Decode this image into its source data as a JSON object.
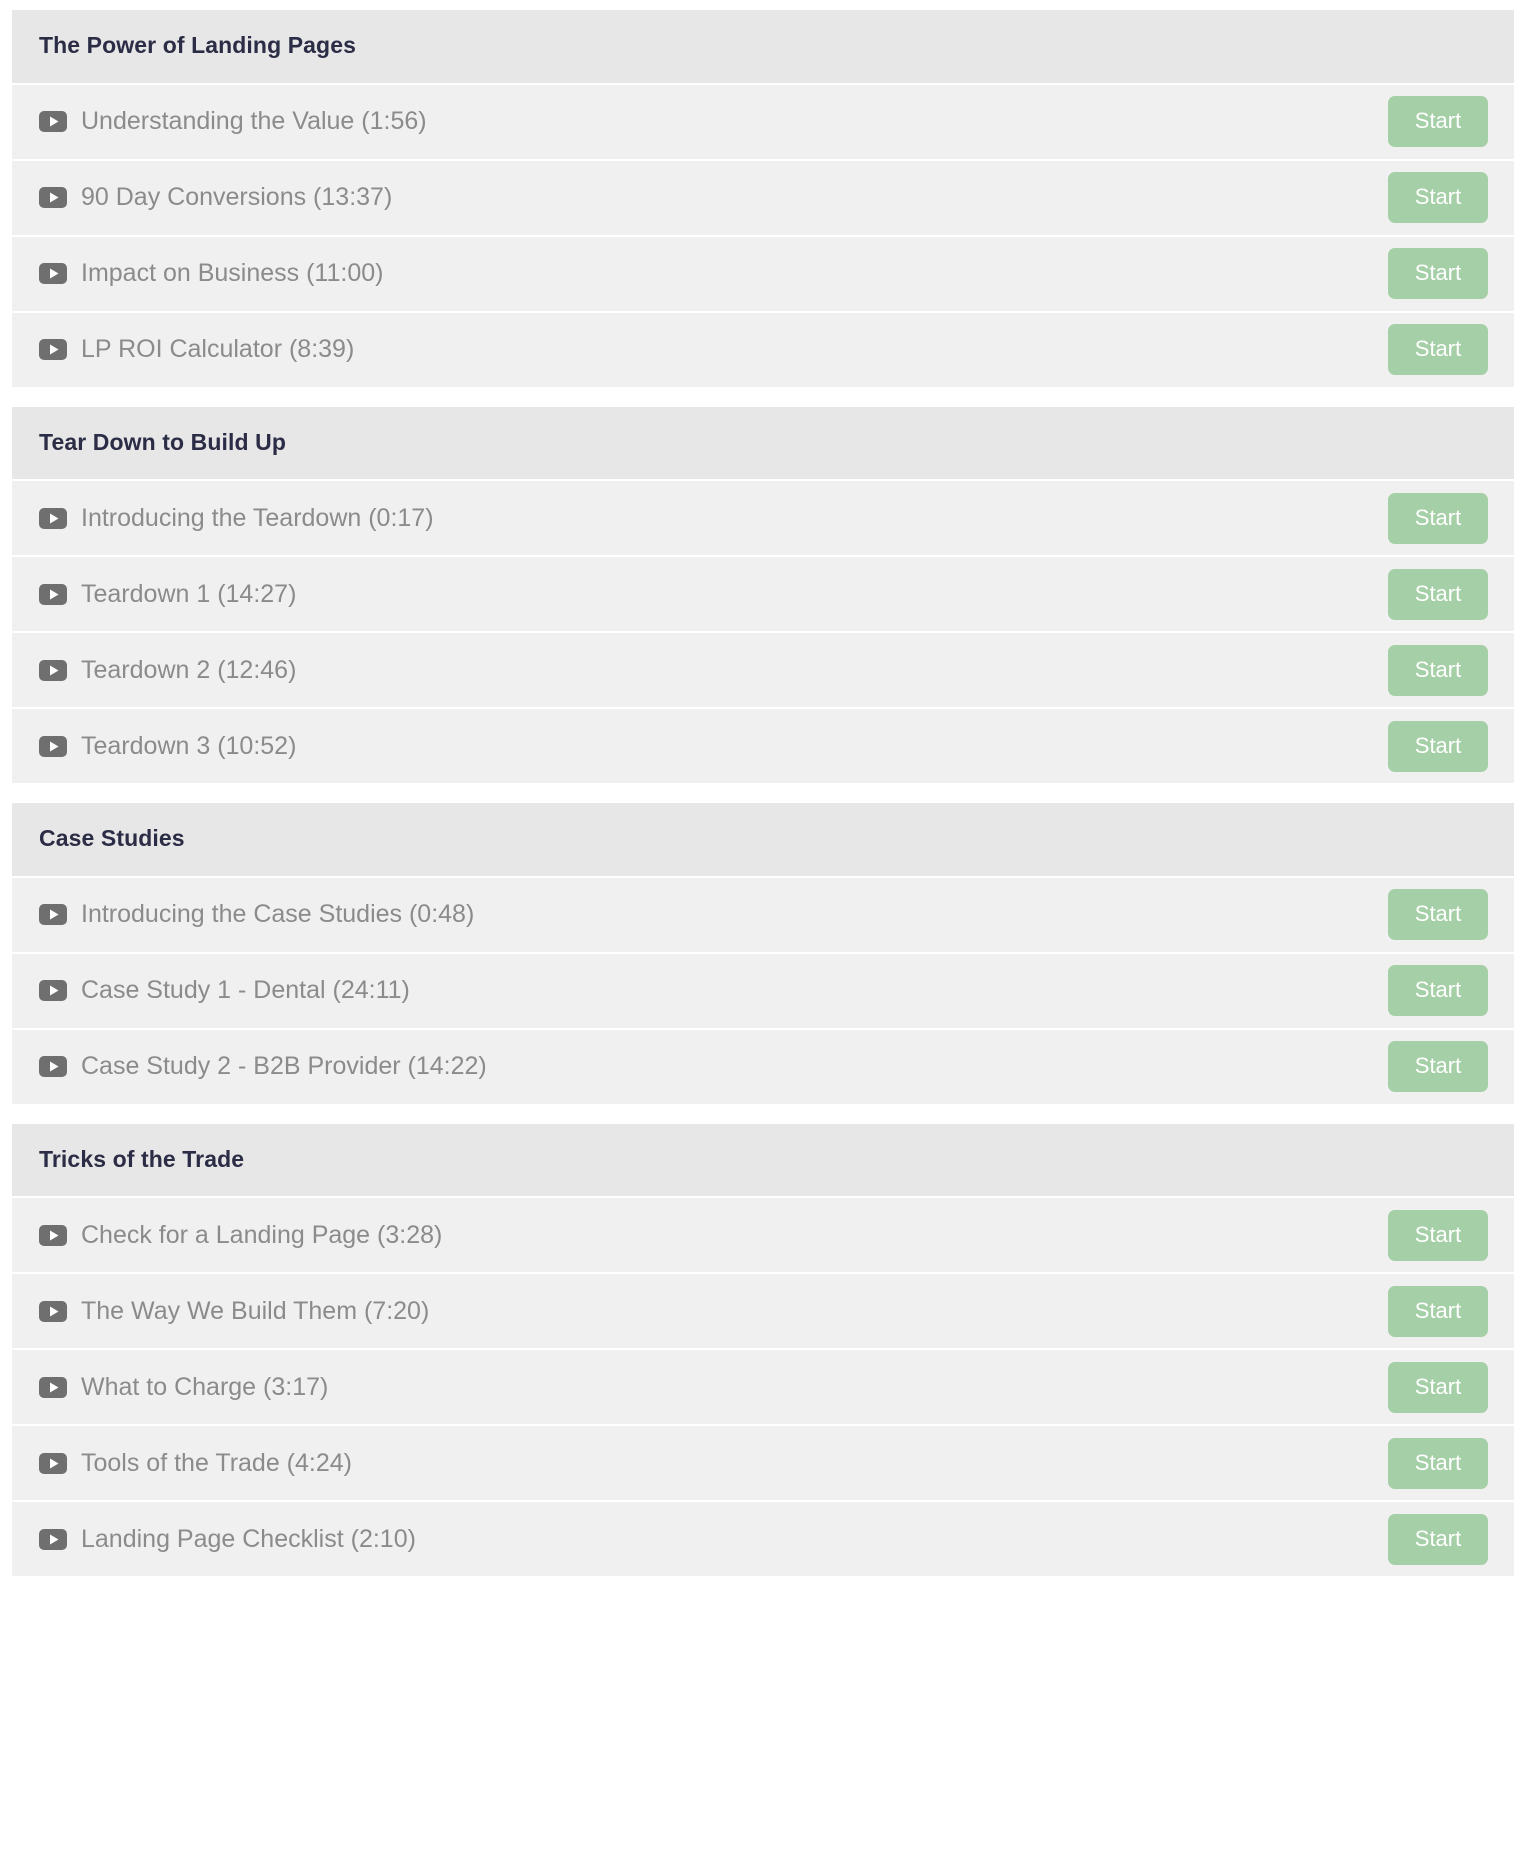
{
  "course": {
    "icon_name": "play-video-icon",
    "accent_color": "#a5cfa6",
    "header_bg": "#e7e7e7",
    "row_bg": "#f0f0f0",
    "title_color": "#2b2c45",
    "label_color": "#8b8b8b",
    "start_label": "Start",
    "sections": [
      {
        "title": "The Power of Landing Pages",
        "lessons": [
          {
            "label": "Understanding the Value (1:56)",
            "title": "Understanding the Value",
            "duration": "1:56",
            "action": "Start"
          },
          {
            "label": "90 Day Conversions (13:37)",
            "title": "90 Day Conversions",
            "duration": "13:37",
            "action": "Start"
          },
          {
            "label": "Impact on Business (11:00)",
            "title": "Impact on Business",
            "duration": "11:00",
            "action": "Start"
          },
          {
            "label": "LP ROI Calculator (8:39)",
            "title": "LP ROI Calculator",
            "duration": "8:39",
            "action": "Start"
          }
        ]
      },
      {
        "title": "Tear Down to Build Up",
        "lessons": [
          {
            "label": "Introducing the Teardown (0:17)",
            "title": "Introducing the Teardown",
            "duration": "0:17",
            "action": "Start"
          },
          {
            "label": "Teardown 1 (14:27)",
            "title": "Teardown 1",
            "duration": "14:27",
            "action": "Start"
          },
          {
            "label": "Teardown 2 (12:46)",
            "title": "Teardown 2",
            "duration": "12:46",
            "action": "Start"
          },
          {
            "label": "Teardown 3 (10:52)",
            "title": "Teardown 3",
            "duration": "10:52",
            "action": "Start"
          }
        ]
      },
      {
        "title": "Case Studies",
        "lessons": [
          {
            "label": "Introducing the Case Studies (0:48)",
            "title": "Introducing the Case Studies",
            "duration": "0:48",
            "action": "Start"
          },
          {
            "label": "Case Study 1 - Dental (24:11)",
            "title": "Case Study 1 - Dental",
            "duration": "24:11",
            "action": "Start"
          },
          {
            "label": "Case Study 2 - B2B Provider (14:22)",
            "title": "Case Study 2 - B2B Provider",
            "duration": "14:22",
            "action": "Start"
          }
        ]
      },
      {
        "title": "Tricks of the Trade",
        "lessons": [
          {
            "label": "Check for a Landing Page (3:28)",
            "title": "Check for a Landing Page",
            "duration": "3:28",
            "action": "Start"
          },
          {
            "label": "The Way We Build Them (7:20)",
            "title": "The Way We Build Them",
            "duration": "7:20",
            "action": "Start"
          },
          {
            "label": "What to Charge (3:17)",
            "title": "What to Charge",
            "duration": "3:17",
            "action": "Start"
          },
          {
            "label": "Tools of the Trade (4:24)",
            "title": "Tools of the Trade",
            "duration": "4:24",
            "action": "Start"
          },
          {
            "label": "Landing Page Checklist (2:10)",
            "title": "Landing Page Checklist",
            "duration": "2:10",
            "action": "Start"
          }
        ]
      }
    ]
  }
}
